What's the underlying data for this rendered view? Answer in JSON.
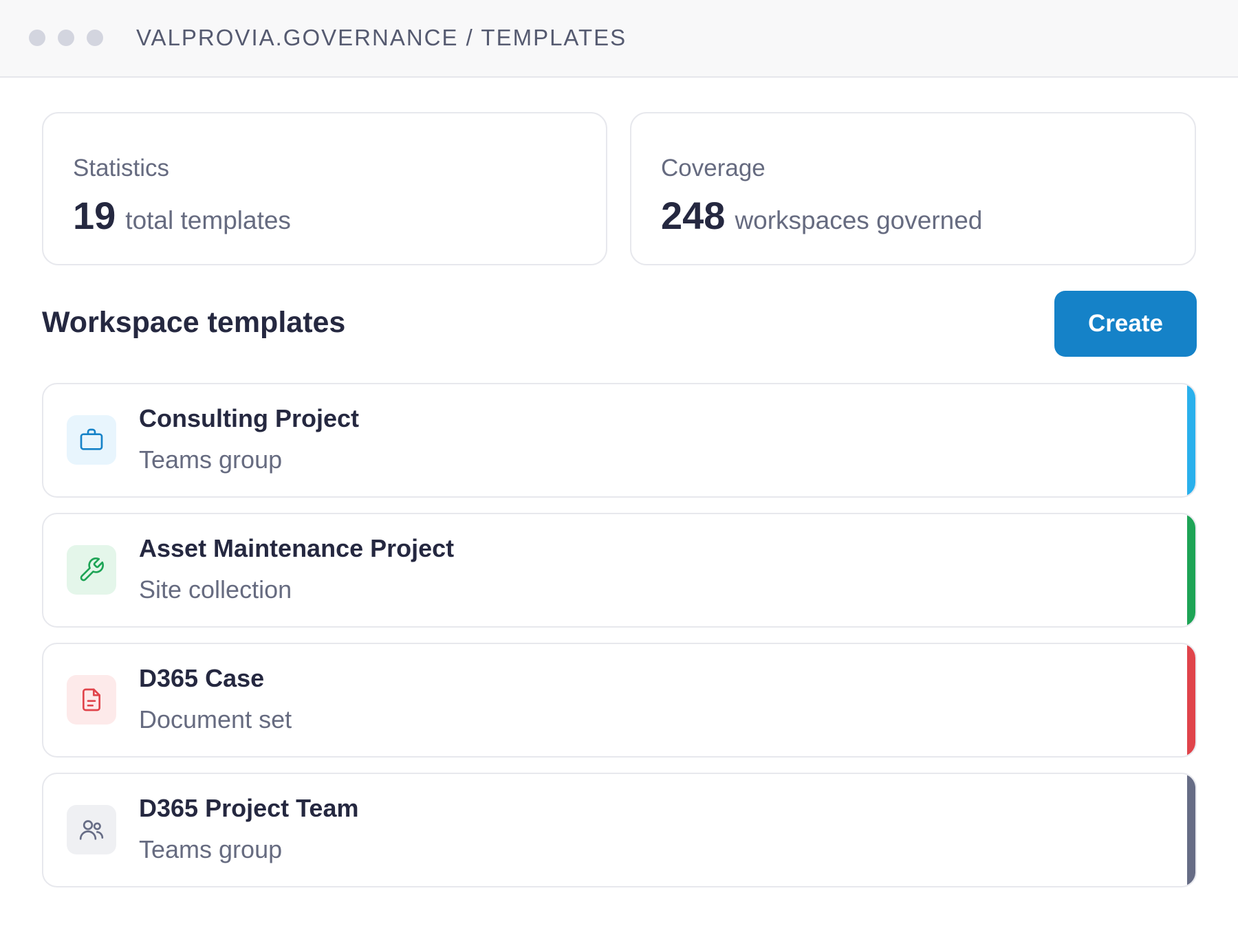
{
  "window": {
    "breadcrumb": "VALPROVIA.GOVERNANCE / TEMPLATES"
  },
  "stats": {
    "statistics": {
      "label": "Statistics",
      "value": "19",
      "unit": "total templates"
    },
    "coverage": {
      "label": "Coverage",
      "value": "248",
      "unit": "workspaces governed"
    }
  },
  "section": {
    "title": "Workspace templates",
    "create_label": "Create"
  },
  "templates": [
    {
      "title": "Consulting Project",
      "type": "Teams group",
      "icon": "briefcase-icon",
      "accent": "#2ab0ec",
      "icon_bg": "#e8f5fd",
      "icon_color": "#1582c8"
    },
    {
      "title": "Asset Maintenance Project",
      "type": "Site collection",
      "icon": "wrench-icon",
      "accent": "#1ea456",
      "icon_bg": "#e4f6ea",
      "icon_color": "#1ea456"
    },
    {
      "title": "D365 Case",
      "type": "Document set",
      "icon": "document-icon",
      "accent": "#e0444b",
      "icon_bg": "#fdeaea",
      "icon_color": "#e0444b"
    },
    {
      "title": "D365 Project Team",
      "type": "Teams group",
      "icon": "users-icon",
      "accent": "#666c85",
      "icon_bg": "#eff0f3",
      "icon_color": "#666c85"
    }
  ]
}
